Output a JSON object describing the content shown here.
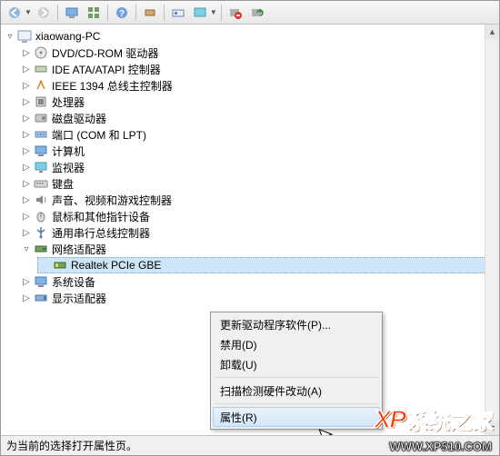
{
  "toolbar_icons": [
    "back",
    "forward",
    "computer",
    "grid",
    "help",
    "plug",
    "eye",
    "monitor",
    "stop",
    "refresh"
  ],
  "tree": {
    "root": {
      "label": "xiaowang-PC",
      "expanded": true,
      "children": [
        {
          "label": "DVD/CD-ROM 驱动器",
          "icon": "disc"
        },
        {
          "label": "IDE ATA/ATAPI 控制器",
          "icon": "ide"
        },
        {
          "label": "IEEE 1394 总线主控制器",
          "icon": "firewire"
        },
        {
          "label": "处理器",
          "icon": "cpu"
        },
        {
          "label": "磁盘驱动器",
          "icon": "disk"
        },
        {
          "label": "端口 (COM 和 LPT)",
          "icon": "port"
        },
        {
          "label": "计算机",
          "icon": "computer"
        },
        {
          "label": "监视器",
          "icon": "monitor"
        },
        {
          "label": "键盘",
          "icon": "keyboard"
        },
        {
          "label": "声音、视频和游戏控制器",
          "icon": "sound"
        },
        {
          "label": "鼠标和其他指针设备",
          "icon": "mouse"
        },
        {
          "label": "通用串行总线控制器",
          "icon": "usb"
        },
        {
          "label": "网络适配器",
          "icon": "network",
          "expanded": true,
          "children": [
            {
              "label": "Realtek PCIe GBE",
              "icon": "nic",
              "selected": true
            }
          ]
        },
        {
          "label": "系统设备",
          "icon": "system"
        },
        {
          "label": "显示适配器",
          "icon": "display"
        }
      ]
    }
  },
  "context_menu": {
    "items": [
      {
        "label": "更新驱动程序软件(P)..."
      },
      {
        "label": "禁用(D)"
      },
      {
        "label": "卸载(U)"
      },
      {
        "sep": true
      },
      {
        "label": "扫描检测硬件改动(A)"
      },
      {
        "sep": true
      },
      {
        "label": "属性(R)",
        "hover": true
      }
    ]
  },
  "statusbar": {
    "text": "为当前的选择打开属性页。"
  },
  "watermark": {
    "logo": "XP",
    "cn": "系统之家",
    "url": "WWW.XP510.COM"
  }
}
